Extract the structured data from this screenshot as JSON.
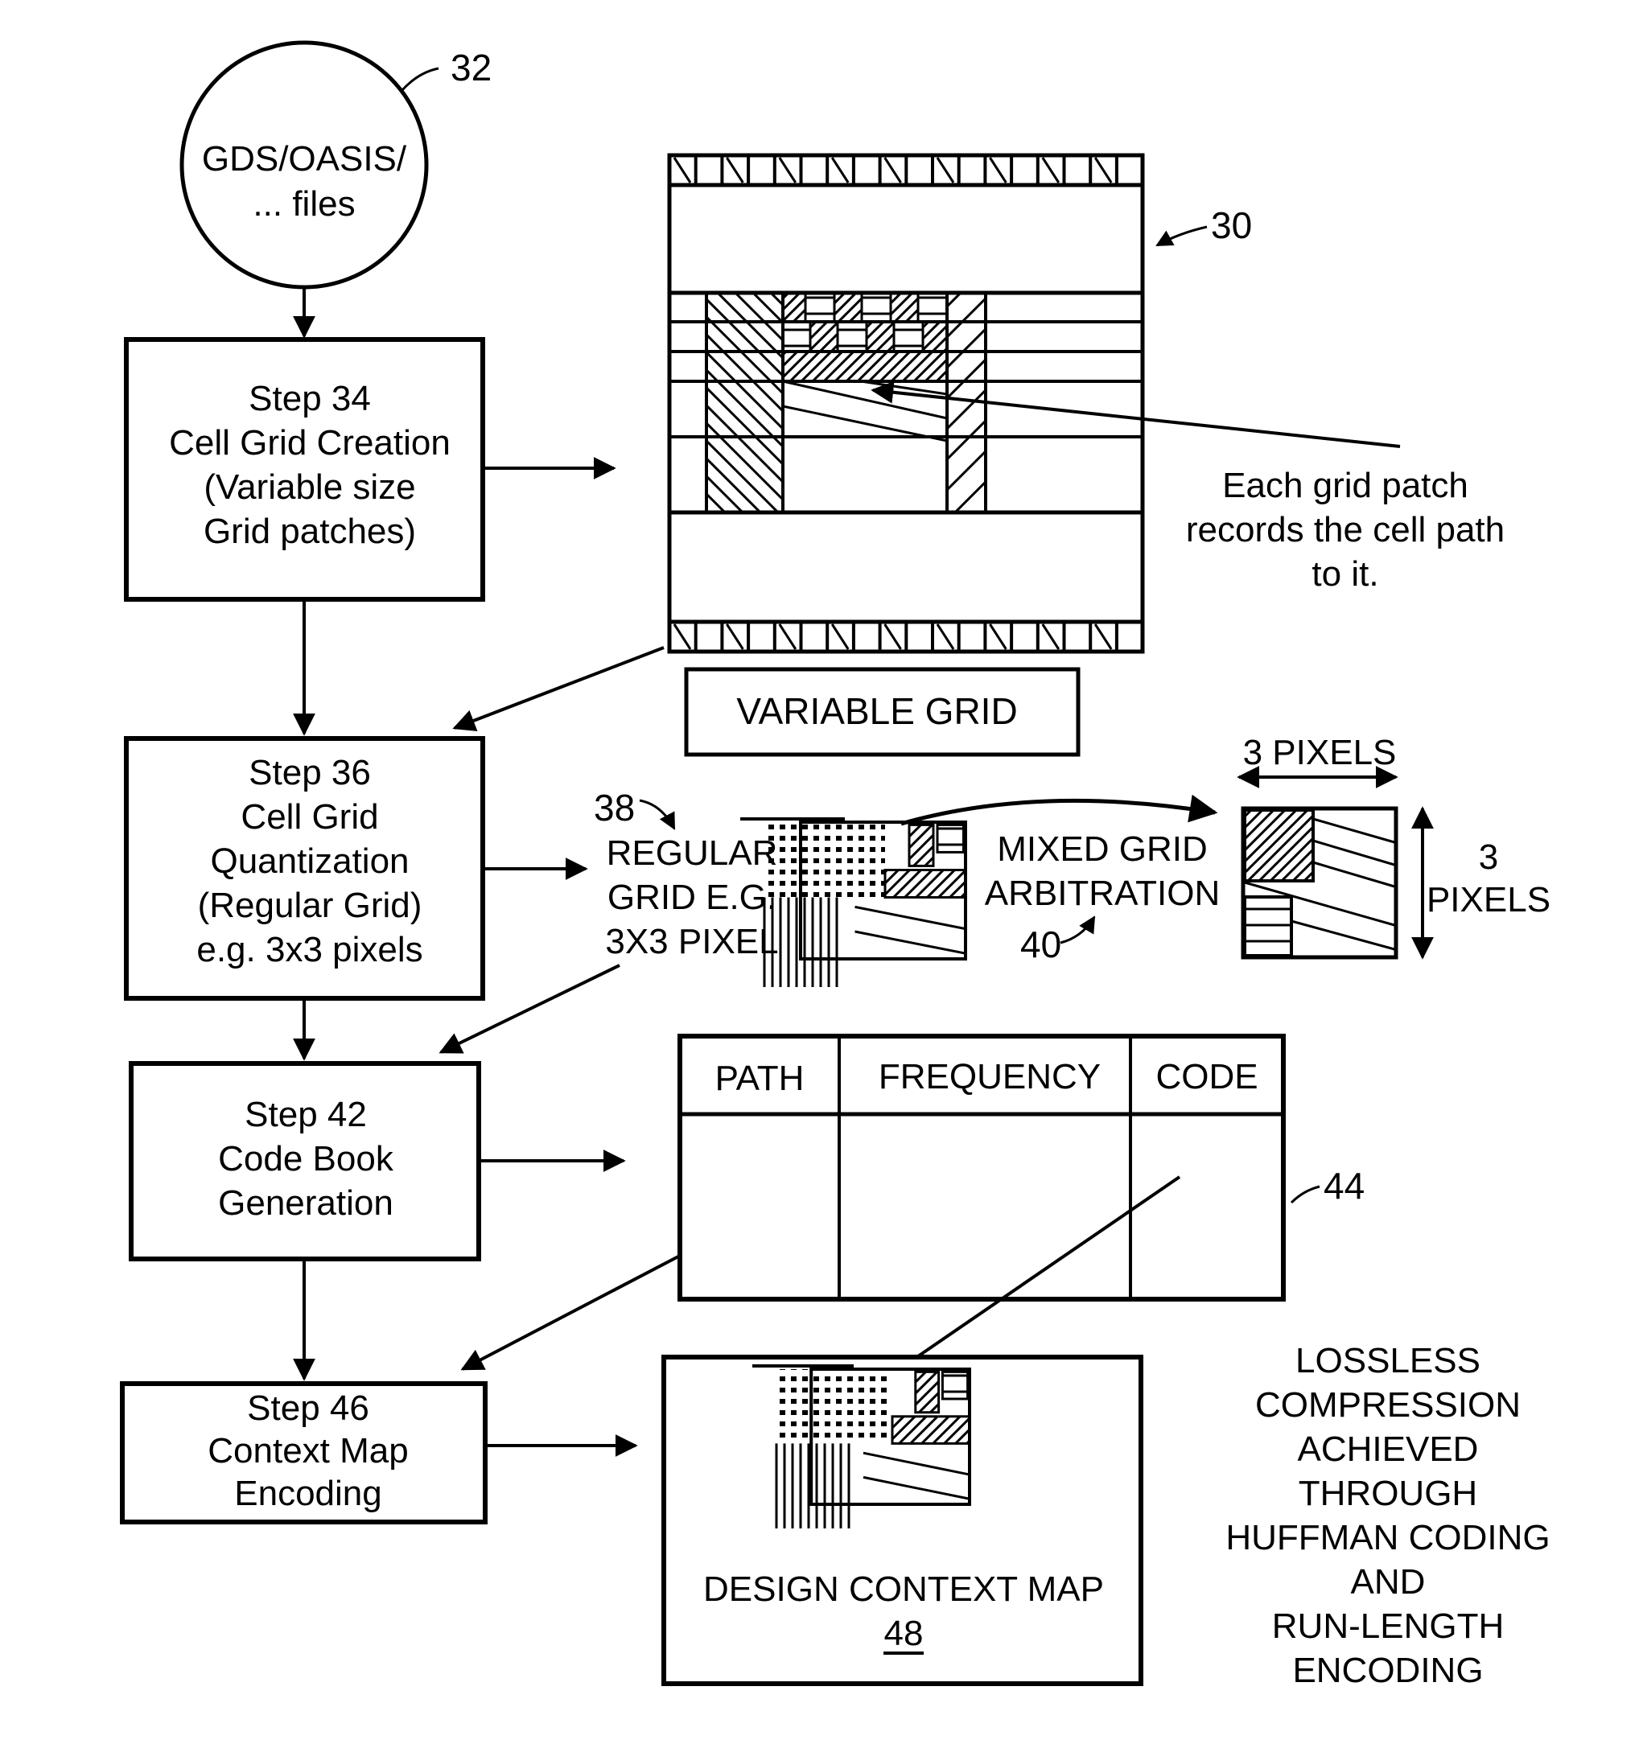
{
  "diagram": {
    "type": "patent-flowchart",
    "colors": {
      "ink": "#000000",
      "background": "#ffffff"
    },
    "source": {
      "ref": "32",
      "lines": [
        "GDS/OASIS/",
        "... files"
      ]
    },
    "steps": [
      {
        "id": "step-34",
        "lines": [
          "Step 34",
          "Cell Grid Creation",
          "(Variable size",
          "Grid patches)"
        ]
      },
      {
        "id": "step-36",
        "lines": [
          "Step 36",
          "Cell Grid",
          "Quantization",
          "(Regular Grid)",
          "e.g. 3x3 pixels"
        ]
      },
      {
        "id": "step-42",
        "lines": [
          "Step 42",
          "Code Book",
          "Generation"
        ]
      },
      {
        "id": "step-46",
        "lines": [
          "Step 46",
          "Context Map",
          "Encoding"
        ]
      }
    ],
    "variable_grid": {
      "ref": "30",
      "label": "VARIABLE GRID",
      "note_lines": [
        "Each grid patch",
        "records the cell path",
        "to it."
      ]
    },
    "regular_grid": {
      "ref": "38",
      "lines": [
        "REGULAR",
        "GRID E.G.",
        "3X3 PIXEL"
      ]
    },
    "mixed_grid": {
      "ref": "40",
      "lines": [
        "MIXED GRID",
        "ARBITRATION"
      ],
      "width_label": "3 PIXELS",
      "height_label_lines": [
        "3",
        "PIXELS"
      ]
    },
    "code_book": {
      "ref": "44",
      "columns": [
        "PATH",
        "FREQUENCY",
        "CODE"
      ],
      "rows": []
    },
    "context_map": {
      "label": "DESIGN CONTEXT MAP",
      "ref": "48"
    },
    "compression_note": {
      "lines": [
        "LOSSLESS",
        "COMPRESSION",
        "ACHIEVED",
        "THROUGH",
        "HUFFMAN CODING",
        "AND",
        "RUN-LENGTH",
        "ENCODING"
      ]
    }
  }
}
